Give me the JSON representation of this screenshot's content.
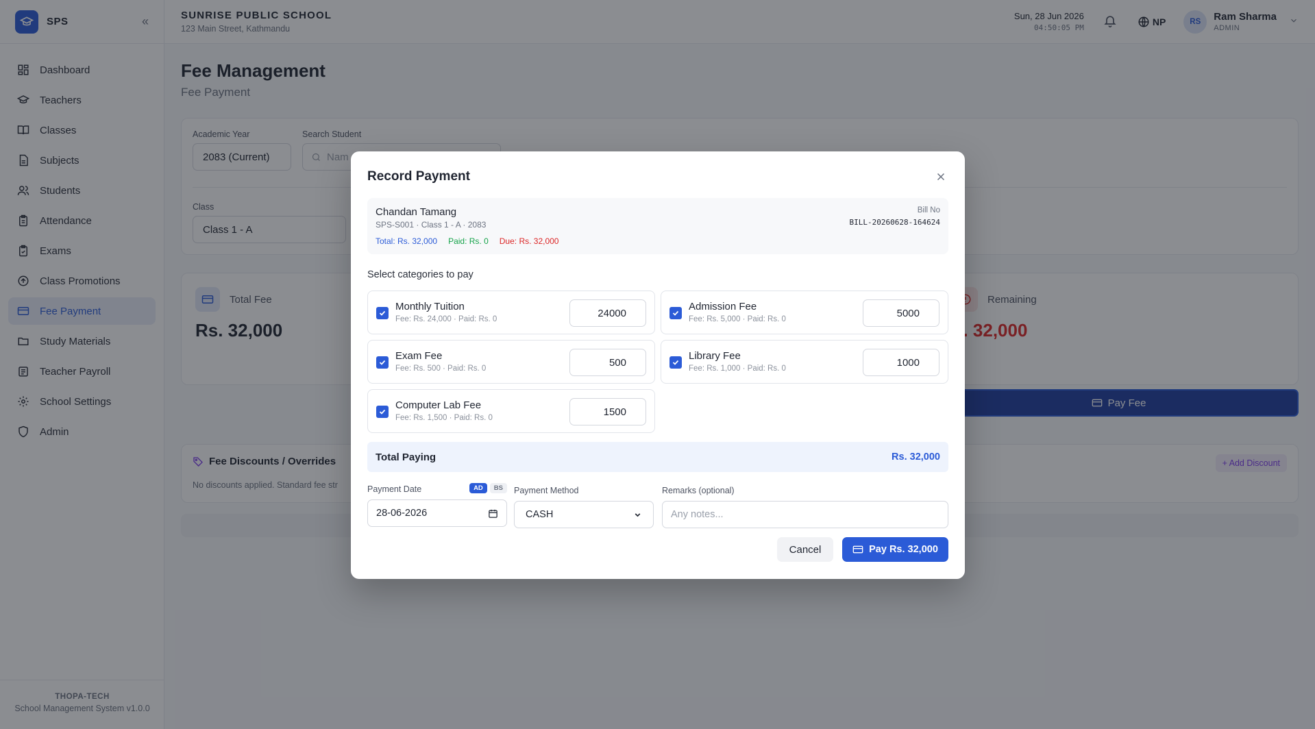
{
  "brand": {
    "short": "SPS"
  },
  "sidebar": {
    "items": [
      {
        "label": "Dashboard",
        "icon": "dashboard-icon"
      },
      {
        "label": "Teachers",
        "icon": "graduation-cap-icon"
      },
      {
        "label": "Classes",
        "icon": "book-open-icon"
      },
      {
        "label": "Subjects",
        "icon": "file-text-icon"
      },
      {
        "label": "Students",
        "icon": "users-icon"
      },
      {
        "label": "Attendance",
        "icon": "clipboard-icon"
      },
      {
        "label": "Exams",
        "icon": "clipboard-check-icon"
      },
      {
        "label": "Class Promotions",
        "icon": "arrow-up-circle-icon"
      },
      {
        "label": "Fee Payment",
        "icon": "credit-card-icon",
        "active": true
      },
      {
        "label": "Study Materials",
        "icon": "folder-icon"
      },
      {
        "label": "Teacher Payroll",
        "icon": "wallet-icon"
      },
      {
        "label": "School Settings",
        "icon": "gear-icon"
      },
      {
        "label": "Admin",
        "icon": "shield-icon"
      }
    ],
    "footer": {
      "company": "THOPA-TECH",
      "version": "School Management System v1.0.0"
    }
  },
  "header": {
    "school_name": "SUNRISE PUBLIC SCHOOL",
    "school_address": "123 Main Street, Kathmandu",
    "date": "Sun, 28 Jun 2026",
    "time": "04:50:05 PM",
    "language": "NP",
    "user": {
      "initials": "RS",
      "name": "Ram Sharma",
      "role": "ADMIN"
    }
  },
  "page": {
    "title": "Fee Management",
    "subtitle": "Fee Payment"
  },
  "filters": {
    "academic_year_label": "Academic Year",
    "academic_year_value": "2083 (Current)",
    "search_label": "Search Student",
    "search_placeholder": "Nam",
    "class_label": "Class",
    "class_value": "Class 1 - A"
  },
  "stats": {
    "total_label": "Total Fee",
    "total_value": "Rs. 32,000",
    "remaining_label": "Remaining",
    "remaining_value": "s. 32,000",
    "pay_button": "Pay Fee"
  },
  "discounts": {
    "title": "Fee Discounts / Overrides",
    "note": "No discounts applied. Standard fee str",
    "add_button": "+ Add Discount"
  },
  "modal": {
    "title": "Record Payment",
    "student": {
      "name": "Chandan Tamang",
      "meta": "SPS-S001 · Class 1 - A · 2083",
      "total": "Total: Rs. 32,000",
      "paid": "Paid: Rs. 0",
      "due": "Due: Rs. 32,000",
      "bill_label": "Bill No",
      "bill_no": "BILL-20260628-164624"
    },
    "select_title": "Select categories to pay",
    "categories": [
      {
        "name": "Monthly Tuition",
        "meta": "Fee: Rs. 24,000 · Paid: Rs. 0",
        "amount": "24000",
        "checked": true
      },
      {
        "name": "Admission Fee",
        "meta": "Fee: Rs. 5,000 · Paid: Rs. 0",
        "amount": "5000",
        "checked": true
      },
      {
        "name": "Exam Fee",
        "meta": "Fee: Rs. 500 · Paid: Rs. 0",
        "amount": "500",
        "checked": true
      },
      {
        "name": "Library Fee",
        "meta": "Fee: Rs. 1,000 · Paid: Rs. 0",
        "amount": "1000",
        "checked": true
      },
      {
        "name": "Computer Lab Fee",
        "meta": "Fee: Rs. 1,500 · Paid: Rs. 0",
        "amount": "1500",
        "checked": true
      }
    ],
    "total_label": "Total Paying",
    "total_value": "Rs. 32,000",
    "payment_date_label": "Payment Date",
    "toggle_ad": "AD",
    "toggle_bs": "BS",
    "payment_date_value": "28-06-2026",
    "payment_method_label": "Payment Method",
    "payment_method_value": "CASH",
    "remarks_label": "Remarks (optional)",
    "remarks_placeholder": "Any notes...",
    "cancel_button": "Cancel",
    "pay_button": "Pay Rs. 32,000"
  },
  "colors": {
    "accent": "#2b5bd7",
    "danger": "#dc2626",
    "success": "#16a34a"
  }
}
